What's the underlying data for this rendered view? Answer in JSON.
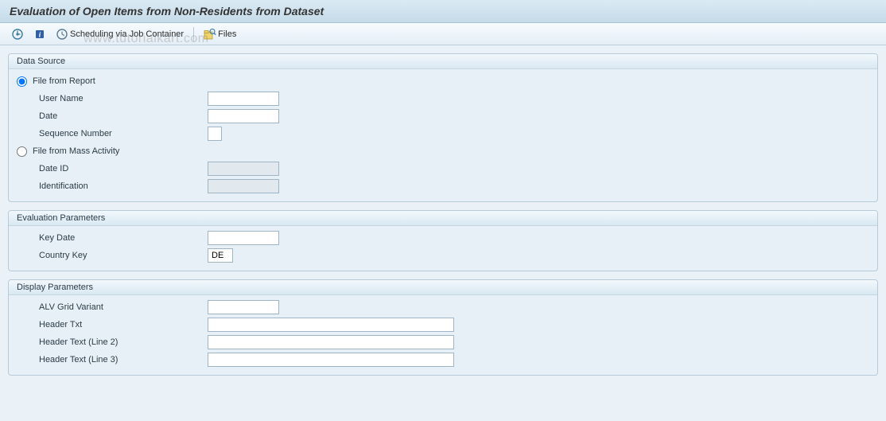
{
  "title": "Evaluation of Open Items from Non-Residents from Dataset",
  "watermark": "www.tutorialkart.com",
  "toolbar": {
    "execute": "",
    "info": "",
    "schedule": "Scheduling via Job Container",
    "files": "Files"
  },
  "groups": {
    "dataSource": {
      "title": "Data Source",
      "radio1": "File from Report",
      "userName_label": "User Name",
      "userName_value": "",
      "date_label": "Date",
      "date_value": "",
      "seqNum_label": "Sequence Number",
      "seqNum_value": "",
      "radio2": "File from Mass Activity",
      "dateId_label": "Date ID",
      "dateId_value": "",
      "ident_label": "Identification",
      "ident_value": ""
    },
    "evalParams": {
      "title": "Evaluation Parameters",
      "keyDate_label": "Key Date",
      "keyDate_value": "",
      "country_label": "Country Key",
      "country_value": "DE"
    },
    "dispParams": {
      "title": "Display Parameters",
      "alv_label": "ALV Grid Variant",
      "alv_value": "",
      "hdr1_label": "Header Txt",
      "hdr1_value": "",
      "hdr2_label": "Header Text (Line 2)",
      "hdr2_value": "",
      "hdr3_label": "Header Text (Line 3)",
      "hdr3_value": ""
    }
  }
}
